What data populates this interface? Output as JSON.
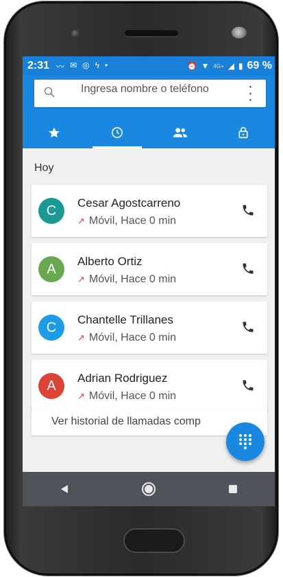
{
  "status_bar": {
    "time": "2:31",
    "battery_percent": "69 %",
    "left_icons": [
      "notification-icon",
      "gmail-icon",
      "instagram-icon",
      "charging-icon",
      "dot-icon"
    ],
    "right_icons": [
      "alarm-icon",
      "wifi-icon",
      "4g-icon",
      "signal-icon",
      "battery-icon"
    ]
  },
  "search": {
    "placeholder": "Ingresa nombre o teléfono"
  },
  "tabs": [
    {
      "icon": "star-icon"
    },
    {
      "icon": "clock-icon",
      "active": true
    },
    {
      "icon": "group-icon"
    },
    {
      "icon": "lock-icon"
    }
  ],
  "section": {
    "label": "Hoy"
  },
  "calls": [
    {
      "initial": "C",
      "name": "Cesar Agostcarreno",
      "detail": "Móvil, Hace 0 min",
      "color": "#1a9a93"
    },
    {
      "initial": "A",
      "name": "Alberto Ortiz",
      "detail": "Móvil, Hace 0 min",
      "color": "#6aa84f"
    },
    {
      "initial": "C",
      "name": "Chantelle Trillanes",
      "detail": "Móvil, Hace 0 min",
      "color": "#1e9be6"
    },
    {
      "initial": "A",
      "name": "Adrian Rodriguez",
      "detail": "Móvil, Hace 0 min",
      "color": "#db4437"
    }
  ],
  "history_link": "Ver historial de llamadas comp",
  "colors": {
    "primary": "#1a87e0",
    "missed_arrow": "#e3337a"
  }
}
